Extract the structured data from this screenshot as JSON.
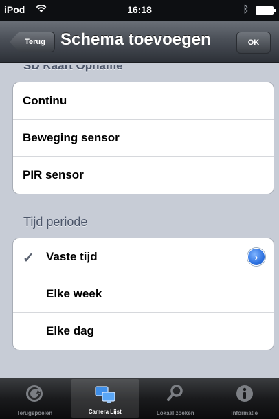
{
  "status_bar": {
    "carrier": "iPod",
    "time": "16:18"
  },
  "nav": {
    "back_label": "Terug",
    "title": "Schema toevoegen",
    "ok_label": "OK"
  },
  "recording_section": {
    "header": "SD Kaart Opname",
    "items": [
      {
        "label": "Continu"
      },
      {
        "label": "Beweging sensor"
      },
      {
        "label": "PIR sensor"
      }
    ]
  },
  "time_section": {
    "header": "Tijd periode",
    "items": [
      {
        "label": "Vaste tijd",
        "checked": true,
        "disclosure": true
      },
      {
        "label": "Elke week"
      },
      {
        "label": "Elke dag"
      }
    ]
  },
  "tabbar": {
    "items": [
      {
        "label": "Terugspoelen",
        "icon": "playback-icon"
      },
      {
        "label": "Camera Lijst",
        "icon": "camera-list-icon",
        "active": true
      },
      {
        "label": "Lokaal zoeken",
        "icon": "search-icon"
      },
      {
        "label": "Informatie",
        "icon": "info-icon"
      }
    ]
  },
  "colors": {
    "accent": "#2e72e0",
    "nav_bg": "#4b5058",
    "page_bg": "#c7ccd6",
    "section_header": "#4c566a"
  }
}
